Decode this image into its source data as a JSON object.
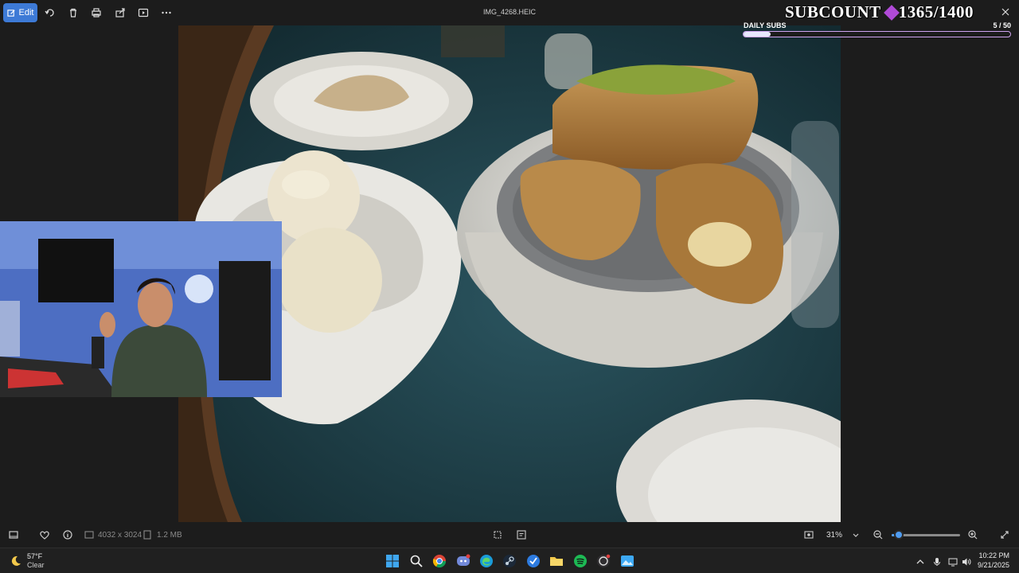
{
  "toolbar": {
    "edit_label": "Edit",
    "icons": [
      "rotate-icon",
      "delete-icon",
      "print-icon",
      "share-icon",
      "slideshow-icon",
      "more-icon"
    ]
  },
  "window": {
    "title": "IMG_4268.HEIC"
  },
  "overlay": {
    "subcount_label": "SUBCOUNT",
    "subcount_value": "1365/1400",
    "daily_label": "DAILY SUBS",
    "daily_current": "5",
    "daily_total": "/ 50",
    "daily_progress": 0.1,
    "accent": "#cfa4f0"
  },
  "bottombar": {
    "dimensions": "4032 x 3024",
    "filesize": "1.2 MB",
    "zoom": "31%",
    "zoom_fraction": 0.1
  },
  "taskbar": {
    "weather_temp": "57°F",
    "weather_desc": "Clear",
    "time": "10:22 PM",
    "date": "9/21/2025",
    "apps": [
      "start-icon",
      "search-icon",
      "chrome-icon",
      "discord-icon",
      "edge-icon",
      "steam-icon",
      "app-icon",
      "file-explorer-icon",
      "spotify-icon",
      "obs-icon",
      "photos-icon"
    ]
  },
  "colors": {
    "accent": "#3d7ad6",
    "background": "#1c1c1c",
    "taskbar": "#202020"
  }
}
